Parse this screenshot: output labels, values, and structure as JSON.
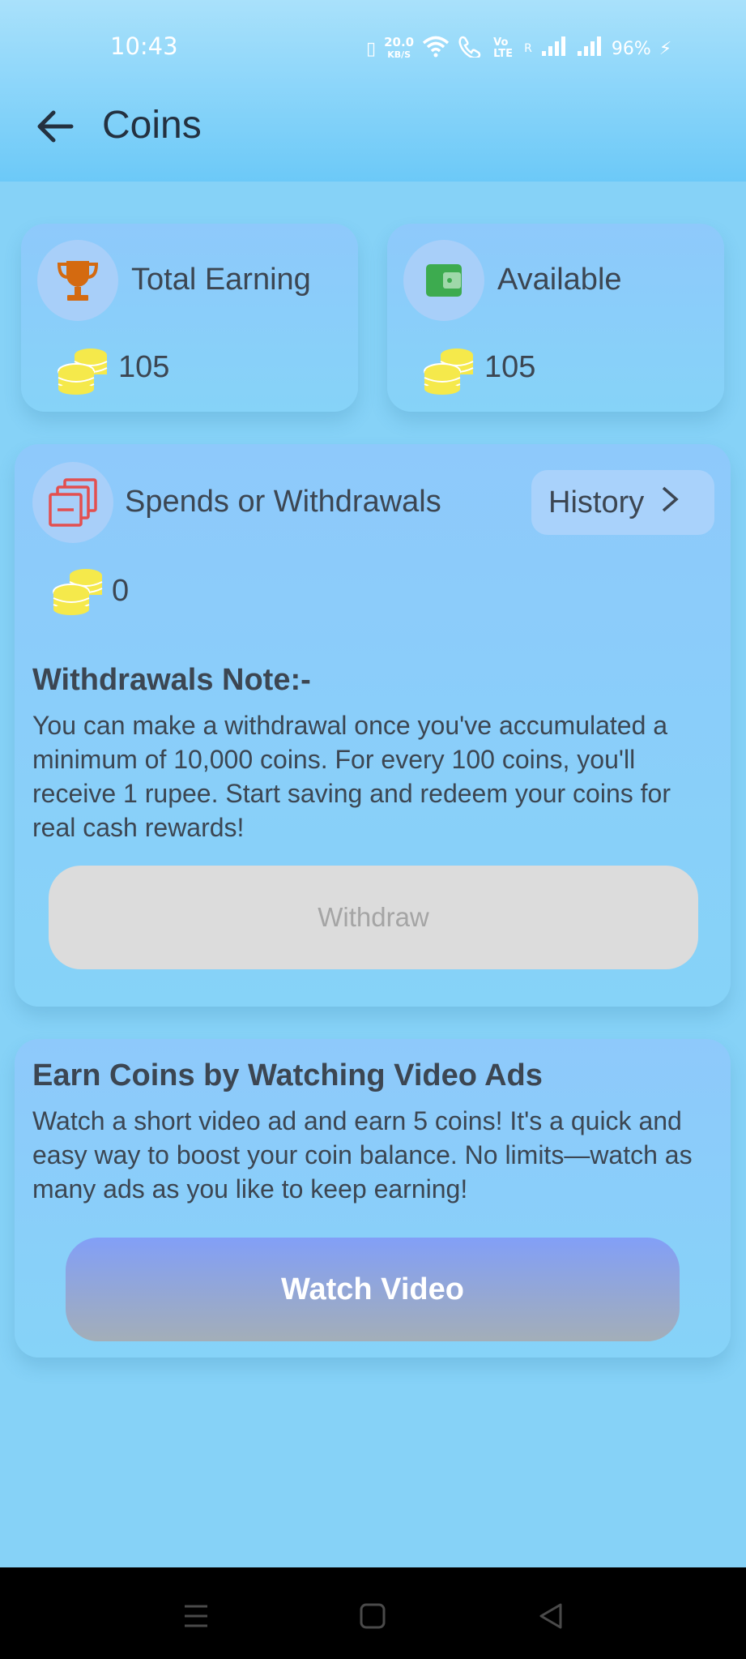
{
  "status_bar": {
    "time": "10:43",
    "net_speed_value": "20.0",
    "net_speed_unit": "KB/S",
    "volte": "Vo LTE",
    "roaming": "R",
    "battery": "96%"
  },
  "app_bar": {
    "title": "Coins"
  },
  "total_earning": {
    "label": "Total Earning",
    "amount": "105"
  },
  "available": {
    "label": "Available",
    "amount": "105"
  },
  "spends": {
    "label": "Spends or Withdrawals",
    "amount": "0",
    "history_label": "History",
    "note_title": "Withdrawals Note:-",
    "note_body": "You can make a withdrawal once you've accumulated a minimum of 10,000 coins. For every 100 coins, you'll receive 1 rupee. Start saving and redeem your coins for real cash rewards!",
    "withdraw_label": "Withdraw"
  },
  "earn": {
    "title": "Earn Coins by Watching Video Ads",
    "body": "Watch a short video ad and earn 5 coins! It's a quick and easy way to boost your coin balance. No limits—watch as many ads as you like to keep earning!",
    "watch_label": "Watch Video"
  },
  "colors": {
    "background": "#86d2f7",
    "card": "#8ec9fb",
    "trophy": "#d46a10",
    "wallet": "#3dab4f",
    "spends_icon": "#e34f4f",
    "coin": "#f5e94b",
    "withdraw_disabled": "#dcdcdc"
  },
  "icons": [
    "back-arrow-icon",
    "trophy-icon",
    "wallet-icon",
    "coin-stack-icon",
    "stacked-cards-icon",
    "chevron-right-icon",
    "menu-icon",
    "home-icon",
    "back-triangle-icon"
  ]
}
